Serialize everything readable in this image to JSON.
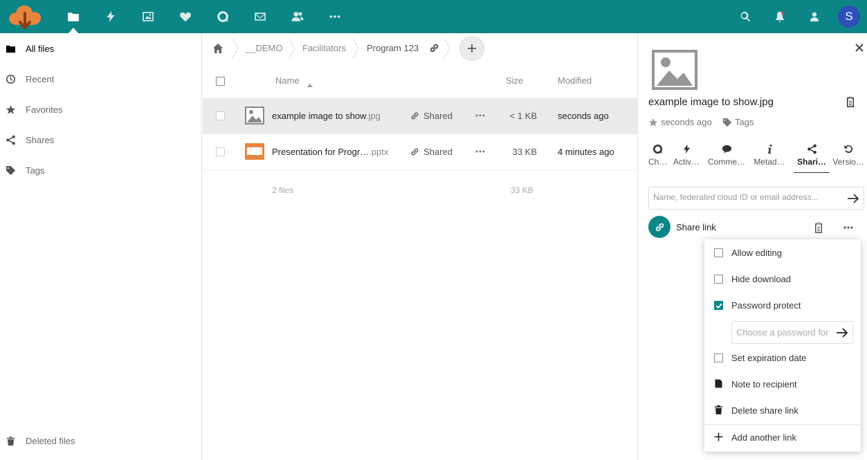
{
  "colors": {
    "brand": "#0b8585",
    "avatar": "#2d4fb8",
    "logo": "#e8853d"
  },
  "header": {
    "apps": [
      "files-icon",
      "activity-icon",
      "photos-icon",
      "favorites-icon",
      "talk-icon",
      "mail-icon",
      "contacts-icon",
      "more-apps-icon"
    ],
    "right_icons": [
      "search-icon",
      "notifications-icon",
      "contacts-menu-icon"
    ],
    "avatar_initial": "S"
  },
  "sidebar": {
    "items": [
      {
        "label": "All files",
        "icon": "folder-icon"
      },
      {
        "label": "Recent",
        "icon": "clock-icon"
      },
      {
        "label": "Favorites",
        "icon": "star-icon"
      },
      {
        "label": "Shares",
        "icon": "share-icon"
      },
      {
        "label": "Tags",
        "icon": "tag-icon"
      }
    ],
    "deleted_label": "Deleted files"
  },
  "breadcrumb": [
    "__DEMO",
    "Facilitators",
    "Program 123"
  ],
  "file_list": {
    "headers": {
      "name": "Name",
      "size": "Size",
      "modified": "Modified"
    },
    "rows": [
      {
        "name": "example image to show",
        "ext": ".jpg",
        "shared": "Shared",
        "size": "< 1 KB",
        "modified": "seconds ago",
        "icon": "image-file-icon"
      },
      {
        "name": "Presentation for Progr…",
        "ext": ".pptx",
        "shared": "Shared",
        "size": "33 KB",
        "modified": "4 minutes ago",
        "icon": "presentation-file-icon"
      }
    ],
    "summary": {
      "count": "2 files",
      "size": "33 KB"
    }
  },
  "detail": {
    "title": "example image to show.jpg",
    "modified": "seconds ago",
    "tags_label": "Tags",
    "tabs": [
      "Ch…",
      "Activ…",
      "Comme…",
      "Metad…",
      "Shari…",
      "Versio…"
    ],
    "share_placeholder": "Name, federated cloud ID or email address...",
    "share_link_label": "Share link"
  },
  "share_menu": {
    "allow_editing": "Allow editing",
    "hide_download": "Hide download",
    "password_protect": "Password protect",
    "password_placeholder": "Choose a password for",
    "set_expiration": "Set expiration date",
    "note_to_recipient": "Note to recipient",
    "delete_link": "Delete share link",
    "add_another": "Add another link"
  }
}
